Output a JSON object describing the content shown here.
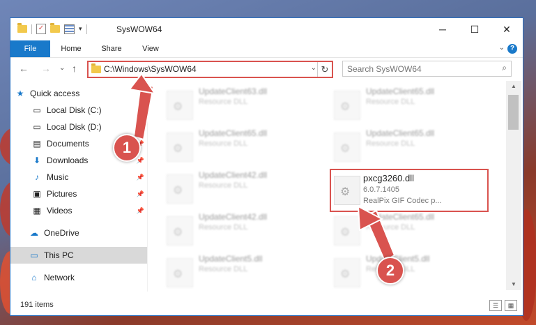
{
  "window": {
    "title": "SysWOW64",
    "minimize": "─",
    "maximize": "☐",
    "close": "✕"
  },
  "ribbon": {
    "tabs": [
      "File",
      "Home",
      "Share",
      "View"
    ],
    "expand": "⌄",
    "help": "?"
  },
  "address": {
    "path": "C:\\Windows\\SysWOW64",
    "refresh": "↻",
    "dropdown": "⌄"
  },
  "search": {
    "placeholder": "Search SysWOW64",
    "icon": "search-icon"
  },
  "nav": {
    "back": "←",
    "forward": "→",
    "recent": "⌄",
    "up": "↑",
    "items": [
      {
        "label": "Quick access",
        "icon": "star-icon",
        "pinned": false
      },
      {
        "label": "Local Disk (C:)",
        "icon": "drive-icon",
        "pinned": true
      },
      {
        "label": "Local Disk (D:)",
        "icon": "drive-icon",
        "pinned": true
      },
      {
        "label": "Documents",
        "icon": "documents-icon",
        "pinned": true
      },
      {
        "label": "Downloads",
        "icon": "download-icon",
        "pinned": true
      },
      {
        "label": "Music",
        "icon": "music-icon",
        "pinned": true
      },
      {
        "label": "Pictures",
        "icon": "pictures-icon",
        "pinned": true
      },
      {
        "label": "Videos",
        "icon": "videos-icon",
        "pinned": true
      },
      {
        "label": "OneDrive",
        "icon": "cloud-icon",
        "pinned": false
      },
      {
        "label": "This PC",
        "icon": "computer-icon",
        "pinned": false
      },
      {
        "label": "Network",
        "icon": "network-icon",
        "pinned": false
      }
    ]
  },
  "files": {
    "left": [
      {
        "name": "UpdateClient63.dll",
        "type": "Resource DLL"
      },
      {
        "name": "UpdateClient65.dll",
        "type": "Resource DLL"
      },
      {
        "name": "UpdateClient42.dll",
        "type": "Resource DLL"
      },
      {
        "name": "UpdateClient42.dll",
        "type": "Resource DLL"
      },
      {
        "name": "UpdateClient5.dll",
        "type": "Resource DLL"
      }
    ],
    "right": [
      {
        "name": "UpdateClient65.dll",
        "type": "Resource DLL"
      },
      {
        "name": "UpdateClient65.dll",
        "type": "Resource DLL"
      },
      {
        "name": "UpdateClient65.dll",
        "type": "Resource DLL"
      },
      {
        "name": "UpdateClient5.dll",
        "type": "Resource DLL"
      }
    ],
    "highlighted": {
      "name": "pxcg3260.dll",
      "version": "6.0.7.1405",
      "description": "RealPix GIF Codec p..."
    }
  },
  "status": {
    "count": "191 items"
  },
  "callouts": [
    "1",
    "2"
  ],
  "colors": {
    "accent": "#1979ca",
    "highlight": "#d9534f"
  }
}
